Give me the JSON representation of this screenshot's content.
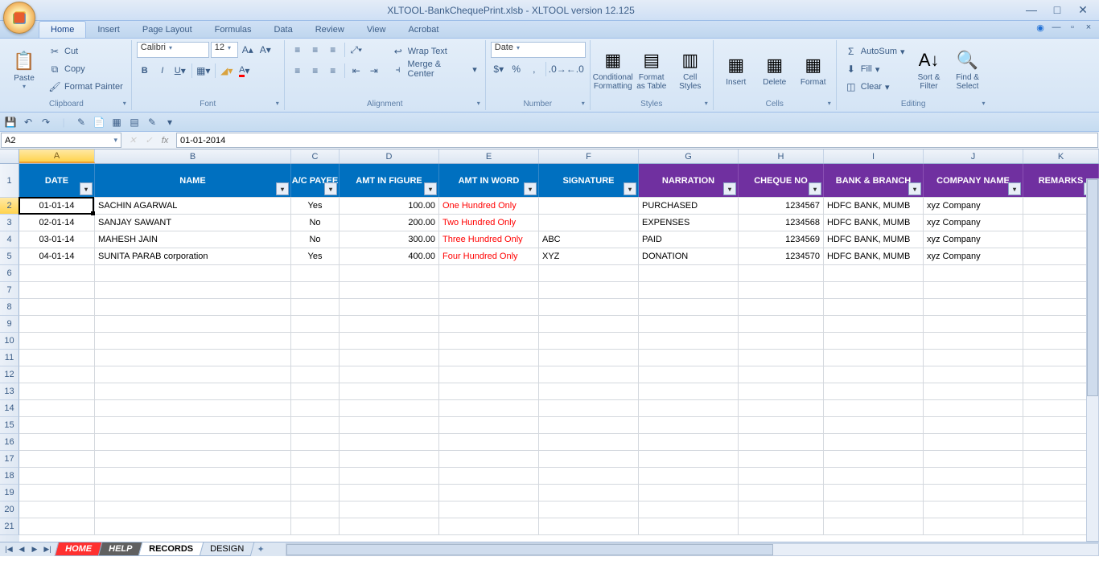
{
  "title": "XLTOOL-BankChequePrint.xlsb - XLTOOL version 12.125",
  "tabs": [
    "Home",
    "Insert",
    "Page Layout",
    "Formulas",
    "Data",
    "Review",
    "View",
    "Acrobat"
  ],
  "ribbon": {
    "clipboard": {
      "label": "Clipboard",
      "paste": "Paste",
      "cut": "Cut",
      "copy": "Copy",
      "painter": "Format Painter"
    },
    "font": {
      "label": "Font",
      "name": "Calibri",
      "size": "12"
    },
    "alignment": {
      "label": "Alignment",
      "wrap": "Wrap Text",
      "merge": "Merge & Center"
    },
    "number": {
      "label": "Number",
      "format": "Date"
    },
    "styles": {
      "label": "Styles",
      "cond": "Conditional Formatting",
      "table": "Format as Table",
      "cell": "Cell Styles"
    },
    "cells": {
      "label": "Cells",
      "insert": "Insert",
      "delete": "Delete",
      "format": "Format"
    },
    "editing": {
      "label": "Editing",
      "autosum": "AutoSum",
      "fill": "Fill",
      "clear": "Clear",
      "sort": "Sort & Filter",
      "find": "Find & Select"
    }
  },
  "namebox": "A2",
  "formula": "01-01-2014",
  "columns": [
    "A",
    "B",
    "C",
    "D",
    "E",
    "F",
    "G",
    "H",
    "I",
    "J",
    "K"
  ],
  "headers": [
    {
      "text": "DATE",
      "style": "blue"
    },
    {
      "text": "NAME",
      "style": "blue"
    },
    {
      "text": "A/C PAYEE",
      "style": "blue"
    },
    {
      "text": "AMT IN FIGURE",
      "style": "blue"
    },
    {
      "text": "AMT IN WORD",
      "style": "blue"
    },
    {
      "text": "SIGNATURE",
      "style": "blue"
    },
    {
      "text": "NARRATION",
      "style": "purple"
    },
    {
      "text": "CHEQUE NO",
      "style": "purple"
    },
    {
      "text": "BANK & BRANCH",
      "style": "purple"
    },
    {
      "text": "COMPANY NAME",
      "style": "purple"
    },
    {
      "text": "REMARKS",
      "style": "purple"
    }
  ],
  "rows": [
    {
      "date": "01-01-14",
      "name": "SACHIN AGARWAL",
      "payee": "Yes",
      "fig": "100.00",
      "word": "One Hundred  Only",
      "sig": "",
      "narr": "PURCHASED",
      "chq": "1234567",
      "bank": "HDFC BANK, MUMB",
      "co": "xyz Company"
    },
    {
      "date": "02-01-14",
      "name": "SANJAY SAWANT",
      "payee": "No",
      "fig": "200.00",
      "word": "Two Hundred  Only",
      "sig": "",
      "narr": "EXPENSES",
      "chq": "1234568",
      "bank": "HDFC BANK, MUMB",
      "co": "xyz Company"
    },
    {
      "date": "03-01-14",
      "name": "MAHESH JAIN",
      "payee": "No",
      "fig": "300.00",
      "word": "Three Hundred  Only",
      "sig": "ABC",
      "narr": "PAID",
      "chq": "1234569",
      "bank": "HDFC BANK, MUMB",
      "co": "xyz Company"
    },
    {
      "date": "04-01-14",
      "name": "SUNITA PARAB corporation",
      "payee": "Yes",
      "fig": "400.00",
      "word": "Four Hundred  Only",
      "sig": "XYZ",
      "narr": "DONATION",
      "chq": "1234570",
      "bank": "HDFC BANK, MUMB",
      "co": "xyz Company"
    }
  ],
  "sheets": {
    "home": "HOME",
    "help": "HELP",
    "records": "RECORDS",
    "design": "DESIGN"
  }
}
